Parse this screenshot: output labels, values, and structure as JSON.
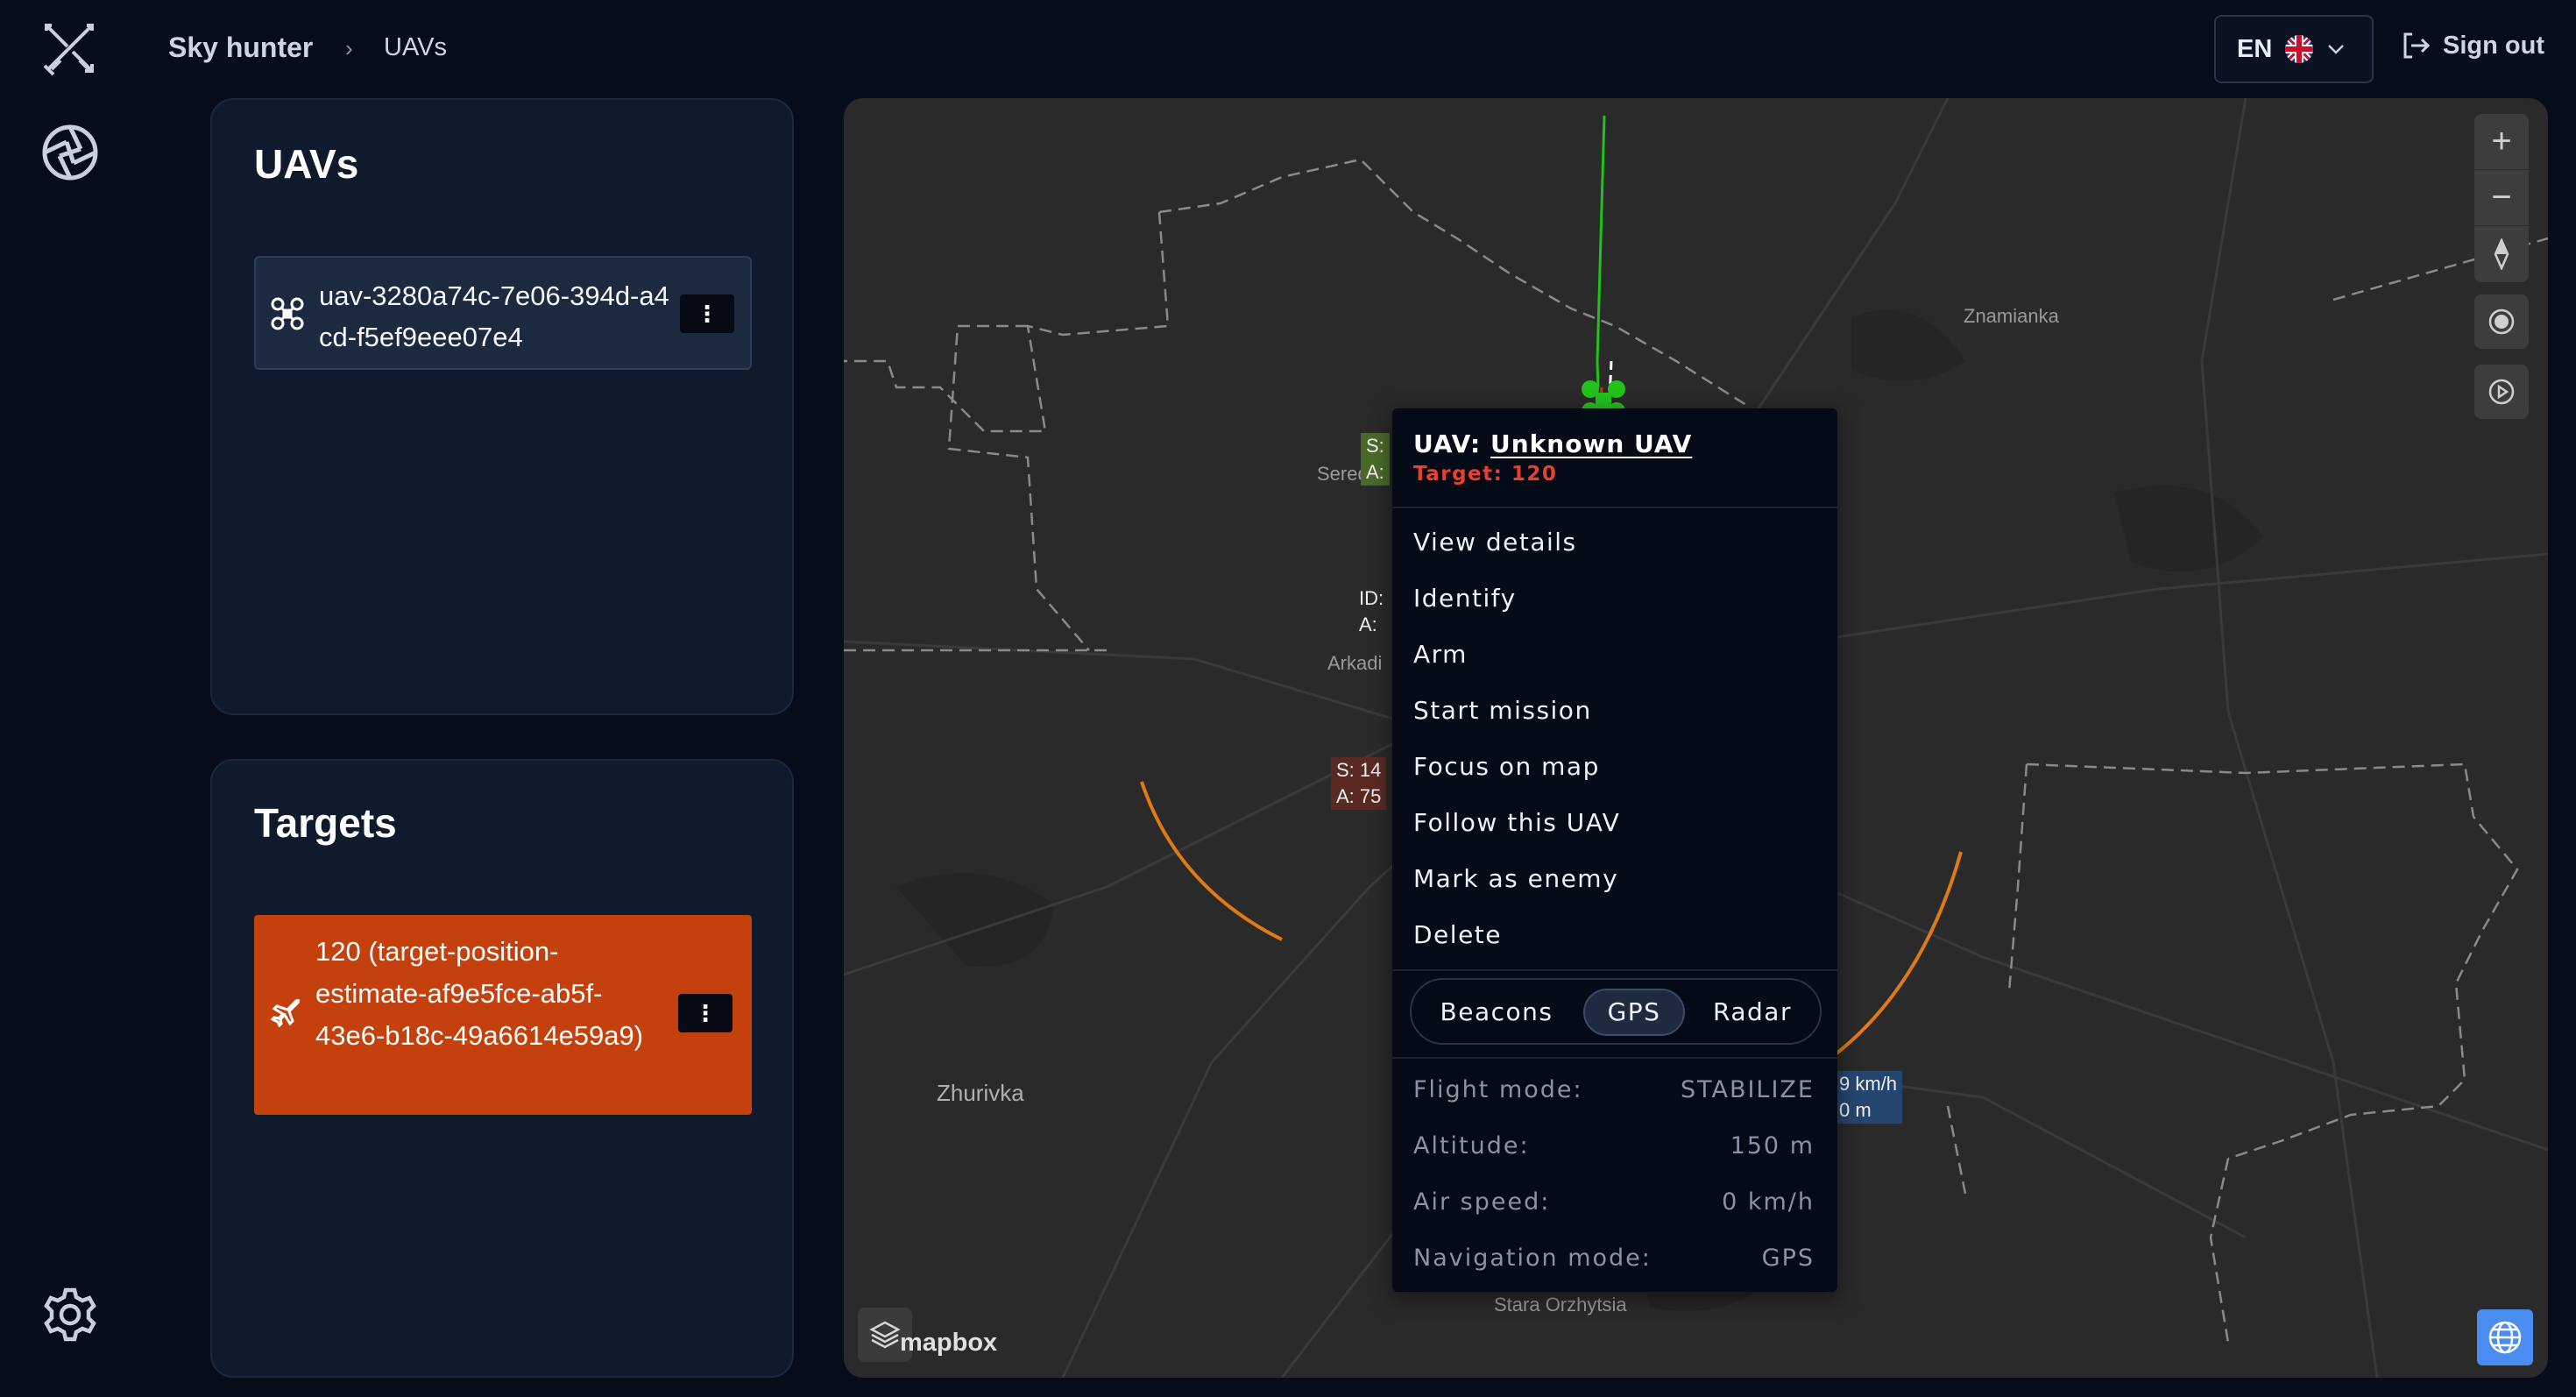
{
  "header": {
    "brand": "Sky hunter",
    "breadcrumb_sep": "›",
    "breadcrumb": "UAVs",
    "language": "EN",
    "sign_out": "Sign out"
  },
  "uav_panel": {
    "title": "UAVs",
    "items": [
      {
        "label": "uav-3280a74c-7e06-394d-a4cd-f5ef9eee07e4",
        "menu": "⋮"
      }
    ]
  },
  "targets_panel": {
    "title": "Targets",
    "items": [
      {
        "label": "120 (target-position-estimate-af9e5fce-ab5f-43e6-b18c-49a6614e59a9)",
        "menu": "⋮",
        "color": "#c4400d"
      }
    ]
  },
  "map": {
    "places": [
      "Znamianka",
      "Sered",
      "Arkadi",
      "Zhurivka",
      "Stara Orzhytsia"
    ],
    "attribution": "mapbox",
    "controls": {
      "zoom_in": "+",
      "zoom_out": "−"
    },
    "tags": [
      {
        "line1": "S:",
        "line2": "A:"
      },
      {
        "line1": "ID:",
        "line2": "A:"
      },
      {
        "line1": "S: 14",
        "line2": "A: 75"
      },
      {
        "line1": "9 km/h",
        "line2": "0 m"
      }
    ],
    "colors": {
      "uav_track": "#22c21d",
      "target_track": "#d62a1a",
      "arc": "#e07a16",
      "bg": "#2a2a2a"
    }
  },
  "popup": {
    "uav_prefix": "UAV:",
    "uav_name": "Unknown UAV",
    "target": "Target: 120",
    "menu": [
      "View details",
      "Identify",
      "Arm",
      "Start mission",
      "Focus on map",
      "Follow this UAV",
      "Mark as enemy",
      "Delete"
    ],
    "sources": {
      "options": [
        "Beacons",
        "GPS",
        "Radar"
      ],
      "selected": "GPS"
    },
    "props": [
      {
        "label": "Flight mode:",
        "value": "STABILIZE"
      },
      {
        "label": "Altitude:",
        "value": "150 m"
      },
      {
        "label": "Air speed:",
        "value": "0 km/h"
      },
      {
        "label": "Navigation mode:",
        "value": "GPS"
      }
    ]
  }
}
